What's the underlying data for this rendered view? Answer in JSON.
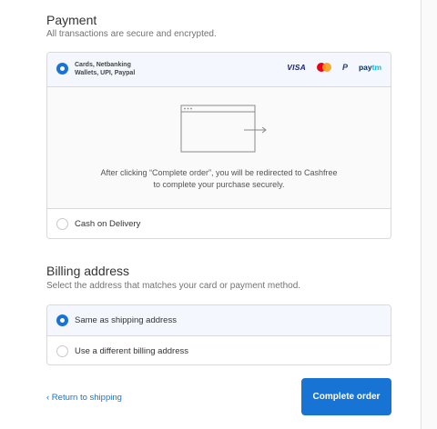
{
  "payment": {
    "title": "Payment",
    "subtitle": "All transactions are secure and encrypted.",
    "options": [
      {
        "label_line1": "Cards, Netbanking",
        "label_line2": "Wallets, UPI, Paypal",
        "selected": true
      },
      {
        "label": "Cash on Delivery",
        "selected": false
      }
    ],
    "logos": [
      "visa-logo",
      "mastercard-logo",
      "paypal-logo",
      "paytm-logo"
    ],
    "logo_text": {
      "visa": "VISA",
      "paypal": "P",
      "paytm_a": "pay",
      "paytm_b": "tm"
    },
    "redirect_line1": "After clicking “Complete order”, you will be redirected to Cashfree",
    "redirect_line2": "to complete your purchase securely."
  },
  "billing": {
    "title": "Billing address",
    "subtitle": "Select the address that matches your card or payment method.",
    "options": [
      {
        "label": "Same as shipping address",
        "selected": true
      },
      {
        "label": "Use a different billing address",
        "selected": false
      }
    ]
  },
  "footer": {
    "back_label": "‹ Return to shipping",
    "cta_label": "Complete order"
  },
  "colors": {
    "accent": "#1773d4",
    "border": "#d9d9d9",
    "selected_row": "#f4f8fe",
    "panel_bg": "#fafafa"
  }
}
